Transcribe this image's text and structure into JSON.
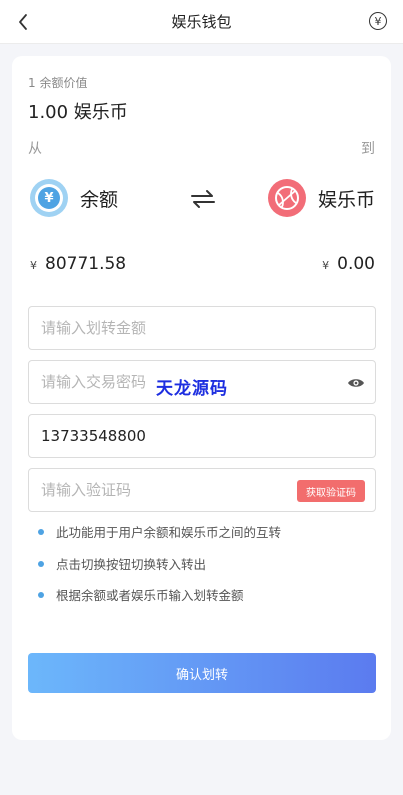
{
  "header": {
    "title": "娱乐钱包",
    "back_icon": "chevron-left-icon",
    "right_icon_glyph": "¥"
  },
  "exchange": {
    "rate_label": "1 余额价值",
    "rate_value": "1.00 娱乐币",
    "from_label": "从",
    "to_label": "到",
    "from_name": "余额",
    "from_icon_glyph": "¥",
    "to_name": "娱乐币",
    "from_currency": "¥",
    "from_amount": "80771.58",
    "to_currency": "¥",
    "to_amount": "0.00"
  },
  "form": {
    "amount_placeholder": "请输入划转金额",
    "password_placeholder": "请输入交易密码",
    "phone_value": "13733548800",
    "code_placeholder": "请输入验证码",
    "get_code_label": "获取验证码",
    "watermark": "天龙源码"
  },
  "tips": [
    "此功能用于用户余额和娱乐币之间的互转",
    "点击切换按钮切换转入转出",
    "根据余额或者娱乐币输入划转金额"
  ],
  "submit_label": "确认划转",
  "colors": {
    "accent_blue": "#4ea3e3",
    "accent_red": "#f26d78",
    "button_gradient_start": "#6cb7fb",
    "button_gradient_end": "#5b7bef"
  }
}
